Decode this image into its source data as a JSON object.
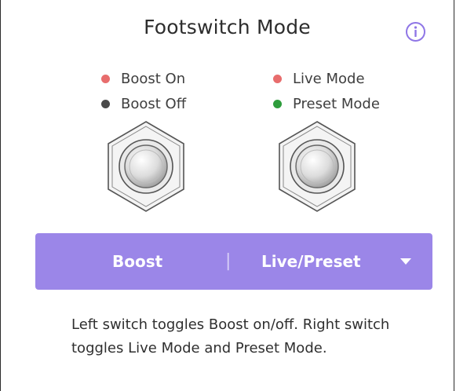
{
  "title": "Footswitch Mode",
  "icons": {
    "info": "info-icon",
    "dropdown": "chevron-down-icon"
  },
  "left_legend": [
    {
      "label": "Boost On",
      "color": "#e86d6d"
    },
    {
      "label": "Boost Off",
      "color": "#4a4a4a"
    }
  ],
  "right_legend": [
    {
      "label": "Live Mode",
      "color": "#e86d6d"
    },
    {
      "label": "Preset Mode",
      "color": "#2e9d3c"
    }
  ],
  "mode_selector": {
    "left_label": "Boost",
    "separator": "|",
    "right_label": "Live/Preset",
    "background": "#9b86e8"
  },
  "description": "Left switch toggles Boost on/off. Right switch toggles Live Mode and Preset Mode.",
  "accent_color": "#8f76e6"
}
